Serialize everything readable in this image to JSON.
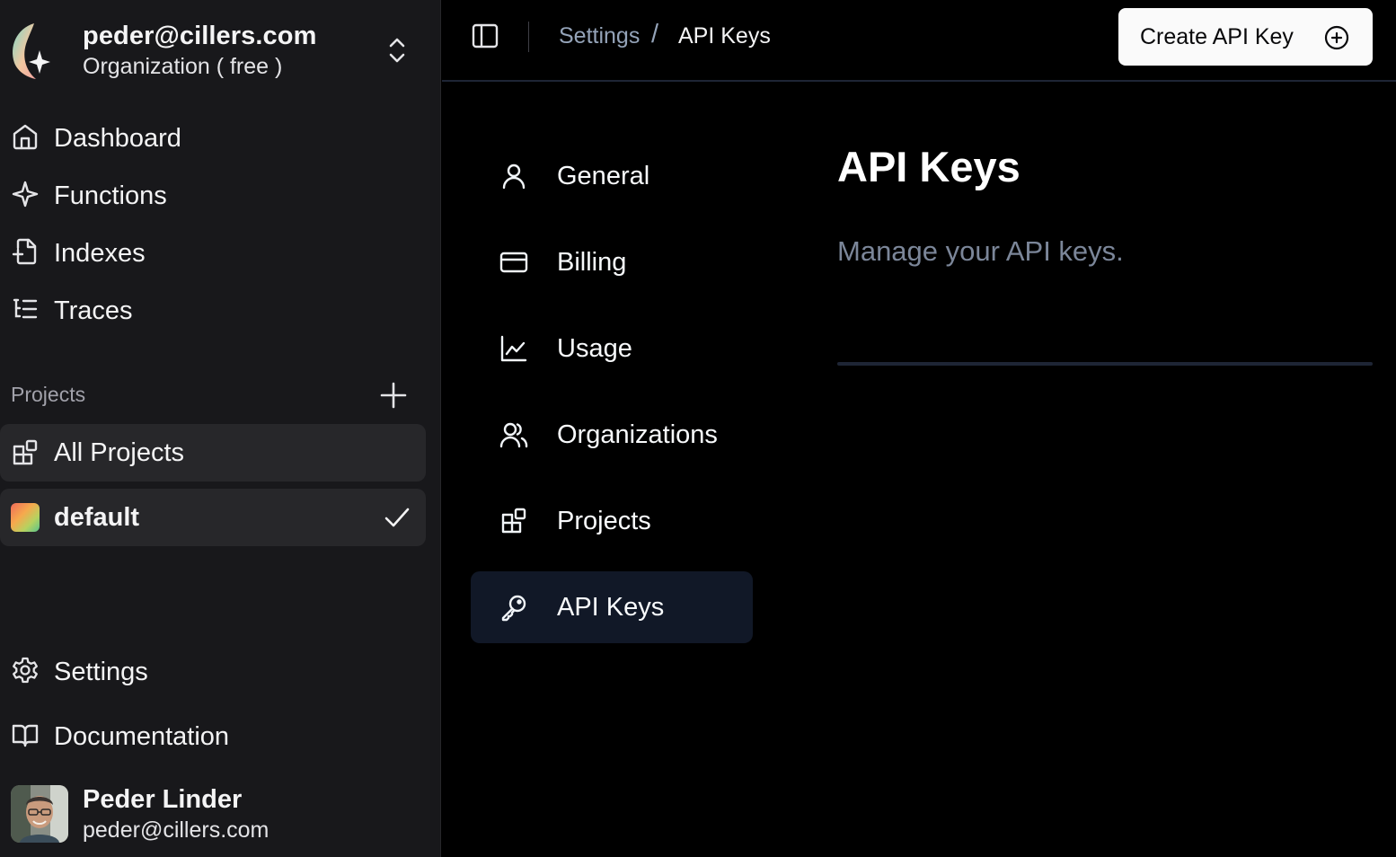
{
  "org": {
    "email": "peder@cillers.com",
    "plan": "Organization ( free )"
  },
  "nav": {
    "items": [
      {
        "label": "Dashboard",
        "icon": "home-icon"
      },
      {
        "label": "Functions",
        "icon": "sparkle-icon"
      },
      {
        "label": "Indexes",
        "icon": "file-plus-icon"
      },
      {
        "label": "Traces",
        "icon": "list-tree-icon"
      }
    ]
  },
  "projects": {
    "heading": "Projects",
    "all_label": "All Projects",
    "items": [
      {
        "label": "default",
        "selected": true
      }
    ]
  },
  "footer_nav": {
    "settings": "Settings",
    "documentation": "Documentation"
  },
  "user": {
    "name": "Peder Linder",
    "email": "peder@cillers.com"
  },
  "header": {
    "breadcrumb": [
      "Settings",
      "/",
      "API Keys"
    ],
    "create_button": "Create API Key"
  },
  "settings_nav": {
    "items": [
      {
        "label": "General",
        "icon": "user-icon"
      },
      {
        "label": "Billing",
        "icon": "credit-card-icon"
      },
      {
        "label": "Usage",
        "icon": "line-chart-icon"
      },
      {
        "label": "Organizations",
        "icon": "users-icon"
      },
      {
        "label": "Projects",
        "icon": "blocks-icon"
      },
      {
        "label": "API Keys",
        "icon": "key-icon",
        "active": true
      }
    ]
  },
  "content": {
    "title": "API Keys",
    "description": "Manage your API keys."
  },
  "colors": {
    "sidebar_bg": "#18181b",
    "main_bg": "#000000",
    "active_item_bg": "#111827",
    "muted_text": "#7b8699",
    "button_bg": "#fafafa"
  }
}
